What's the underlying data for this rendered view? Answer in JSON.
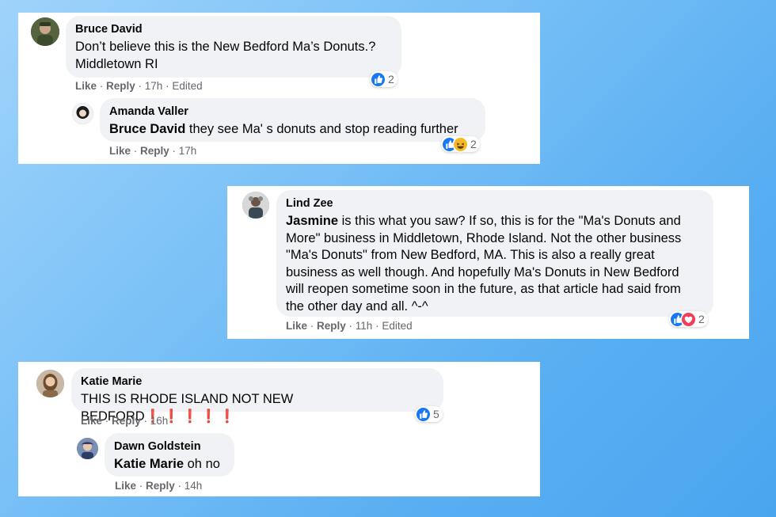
{
  "colors": {
    "accent": "#1877f2",
    "background_gradient": [
      "#9fd3fb",
      "#4aa5ef"
    ]
  },
  "card1": {
    "c1": {
      "author": "Bruce David",
      "text_line1": "Don’t believe this is the New Bedford Ma’s Donuts.?",
      "text_line2": "Middletown RI",
      "like": "Like",
      "reply": "Reply",
      "time": "17h",
      "edited": "Edited",
      "reaction_count": "2",
      "reaction_icons": [
        "like-icon"
      ]
    },
    "c2": {
      "author": "Amanda Valler",
      "mention": "Bruce David",
      "text": " they see Ma' s donuts and stop reading further",
      "like": "Like",
      "reply": "Reply",
      "time": "17h",
      "reaction_count": "2",
      "reaction_icons": [
        "like-icon",
        "haha-icon"
      ]
    }
  },
  "card2": {
    "c1": {
      "author": "Lind Zee",
      "mention": "Jasmine",
      "line1": " is this what you saw? If so, this is for the \"Ma's Donuts and",
      "line2": "More\" business in Middletown, Rhode Island. Not the other business",
      "line3": "\"Ma's Donuts\" from New Bedford, MA. This is also a really great",
      "line4": "business as well though. And hopefully Ma's Donuts in New Bedford",
      "line5": "will reopen sometime soon in the future, as that article had said from",
      "line6": "the other day and all. ^-^",
      "like": "Like",
      "reply": "Reply",
      "time": "11h",
      "edited": "Edited",
      "reaction_count": "2",
      "reaction_icons": [
        "like-icon",
        "love-icon"
      ]
    }
  },
  "card3": {
    "c1": {
      "author": "Katie Marie",
      "text": "THIS IS RHODE ISLAND NOT NEW BEDFORD",
      "emphasis": "❗❗❗❗❗",
      "like": "Like",
      "reply": "Reply",
      "time": "16h",
      "reaction_count": "5",
      "reaction_icons": [
        "like-icon"
      ]
    },
    "c2": {
      "author": "Dawn Goldstein",
      "mention": "Katie Marie",
      "text": " oh no",
      "like": "Like",
      "reply": "Reply",
      "time": "14h"
    }
  },
  "separator": " · "
}
